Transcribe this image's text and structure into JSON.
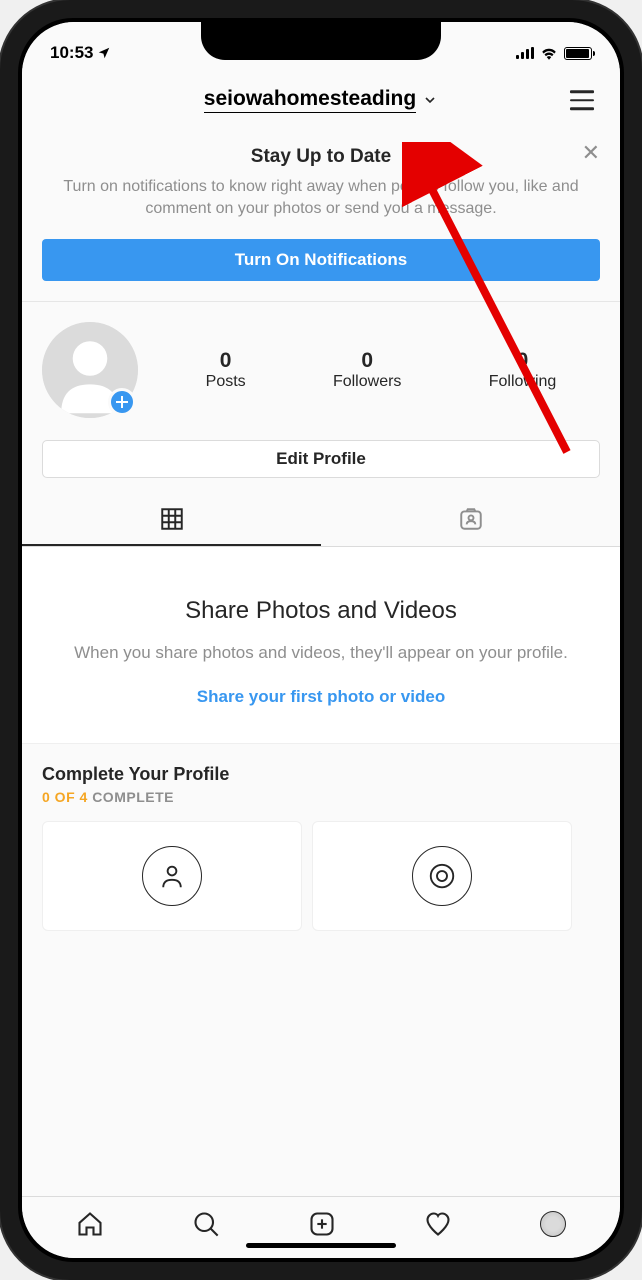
{
  "status": {
    "time": "10:53",
    "location_icon": "location-arrow"
  },
  "header": {
    "username": "seiowahomesteading"
  },
  "notification_banner": {
    "title": "Stay Up to Date",
    "text": "Turn on notifications to know right away when people follow you, like and comment on your photos or send you a message.",
    "button": "Turn On Notifications"
  },
  "stats": {
    "posts": {
      "count": "0",
      "label": "Posts"
    },
    "followers": {
      "count": "0",
      "label": "Followers"
    },
    "following": {
      "count": "0",
      "label": "Following"
    }
  },
  "edit_profile_label": "Edit Profile",
  "empty_state": {
    "title": "Share Photos and Videos",
    "text": "When you share photos and videos, they'll appear on your profile.",
    "link": "Share your first photo or video"
  },
  "complete_profile": {
    "title": "Complete Your Profile",
    "progress_done": "0 OF 4",
    "progress_label": "COMPLETE"
  }
}
